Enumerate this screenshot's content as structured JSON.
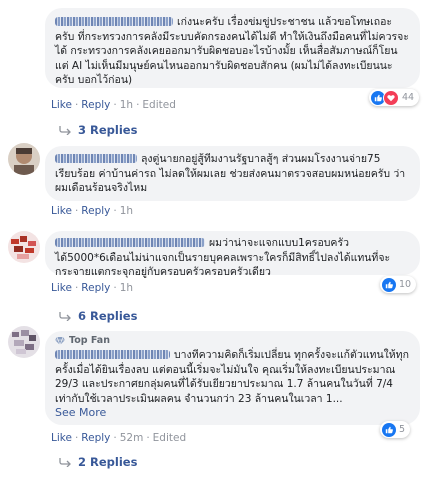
{
  "comments": [
    {
      "text": "เก่งนะครับ เรื่องข่มขู่ประชาชน แล้วขอโทษเถอะครับ ที่กระทรวงการคลังมีระบบคัดกรองคนได้ไม่ดี ทำให้เงินถึงมือคนที่ไม่ควรจะได้ กระทรวงการคลังเคยออกมารับผิดชอบอะไรบ้างมั้ย เห็นสื่อสัมภาษณ์ก็โยนแต่ AI ไม่เห็นมีมนุษย์คนไหนออกมารับผิดชอบสักคน (ผมไม่ได้ลงทะเบียนนะครับ บอกไว้ก่อน)",
      "like": "Like",
      "reply": "Reply",
      "time": "1h",
      "edited": "Edited",
      "reaction_count": "44",
      "replies_label": "3 Replies"
    },
    {
      "text": "ลุงตู่นายกอยู่สู้ทีมงานรัฐบาลสู้ๆ ส่วนผมโรงงานจ่าย75 เรียบร้อย ค่าบ้านค่ารถ ไม่ลดให้ผมเลย ช่วยส่งคนมาตรวจสอบผมหน่อยครับ ว่าผมเดือนร้อนจริงไหม",
      "like": "Like",
      "reply": "Reply",
      "time": "1h"
    },
    {
      "text": "ผมว่าน่าจะแจกแบบ1ครอบครัวได้5000*6เดือนไม่น่าแจกเป็นรายบุคคลเพราะใครก็มีสิทธิ์ไปลงได้แทนที่จะกระจายแตกระจุกอยู่กับครอบครัวครอบครัวเดียว",
      "like": "Like",
      "reply": "Reply",
      "time": "1h",
      "reaction_count": "10",
      "replies_label": "6 Replies"
    },
    {
      "badge": "Top Fan",
      "text": "บางทีความคิดก็เริ่มเปลี่ยน ทุกครั้งจะแก้ตัวแทนให้ทุกครั้งเมื่อได้ยินเรื่องลบ แต่ตอนนี้เริ่มจะไม่มันใจ คุณเริ่มให้ลงทะเบียนประมาณ 29/3 และประกาศยกลุ่มคนที่ได้รับเยียวยาประมาณ 1.7 ล้านคนในวันที่ 7/4 เท่ากับใช้เวลาประเมินผลคน จำนวนกว่า 23 ล้านคนในเวลา 1...",
      "see_more": "See More",
      "like": "Like",
      "reply": "Reply",
      "time": "52m",
      "edited": "Edited",
      "reaction_count": "5",
      "replies_label": "2 Replies"
    }
  ],
  "colors": {
    "link": "#385898",
    "meta": "#90949c",
    "bubble": "#f2f3f5",
    "like_blue": "#1877f2",
    "love_red": "#f33e58"
  }
}
